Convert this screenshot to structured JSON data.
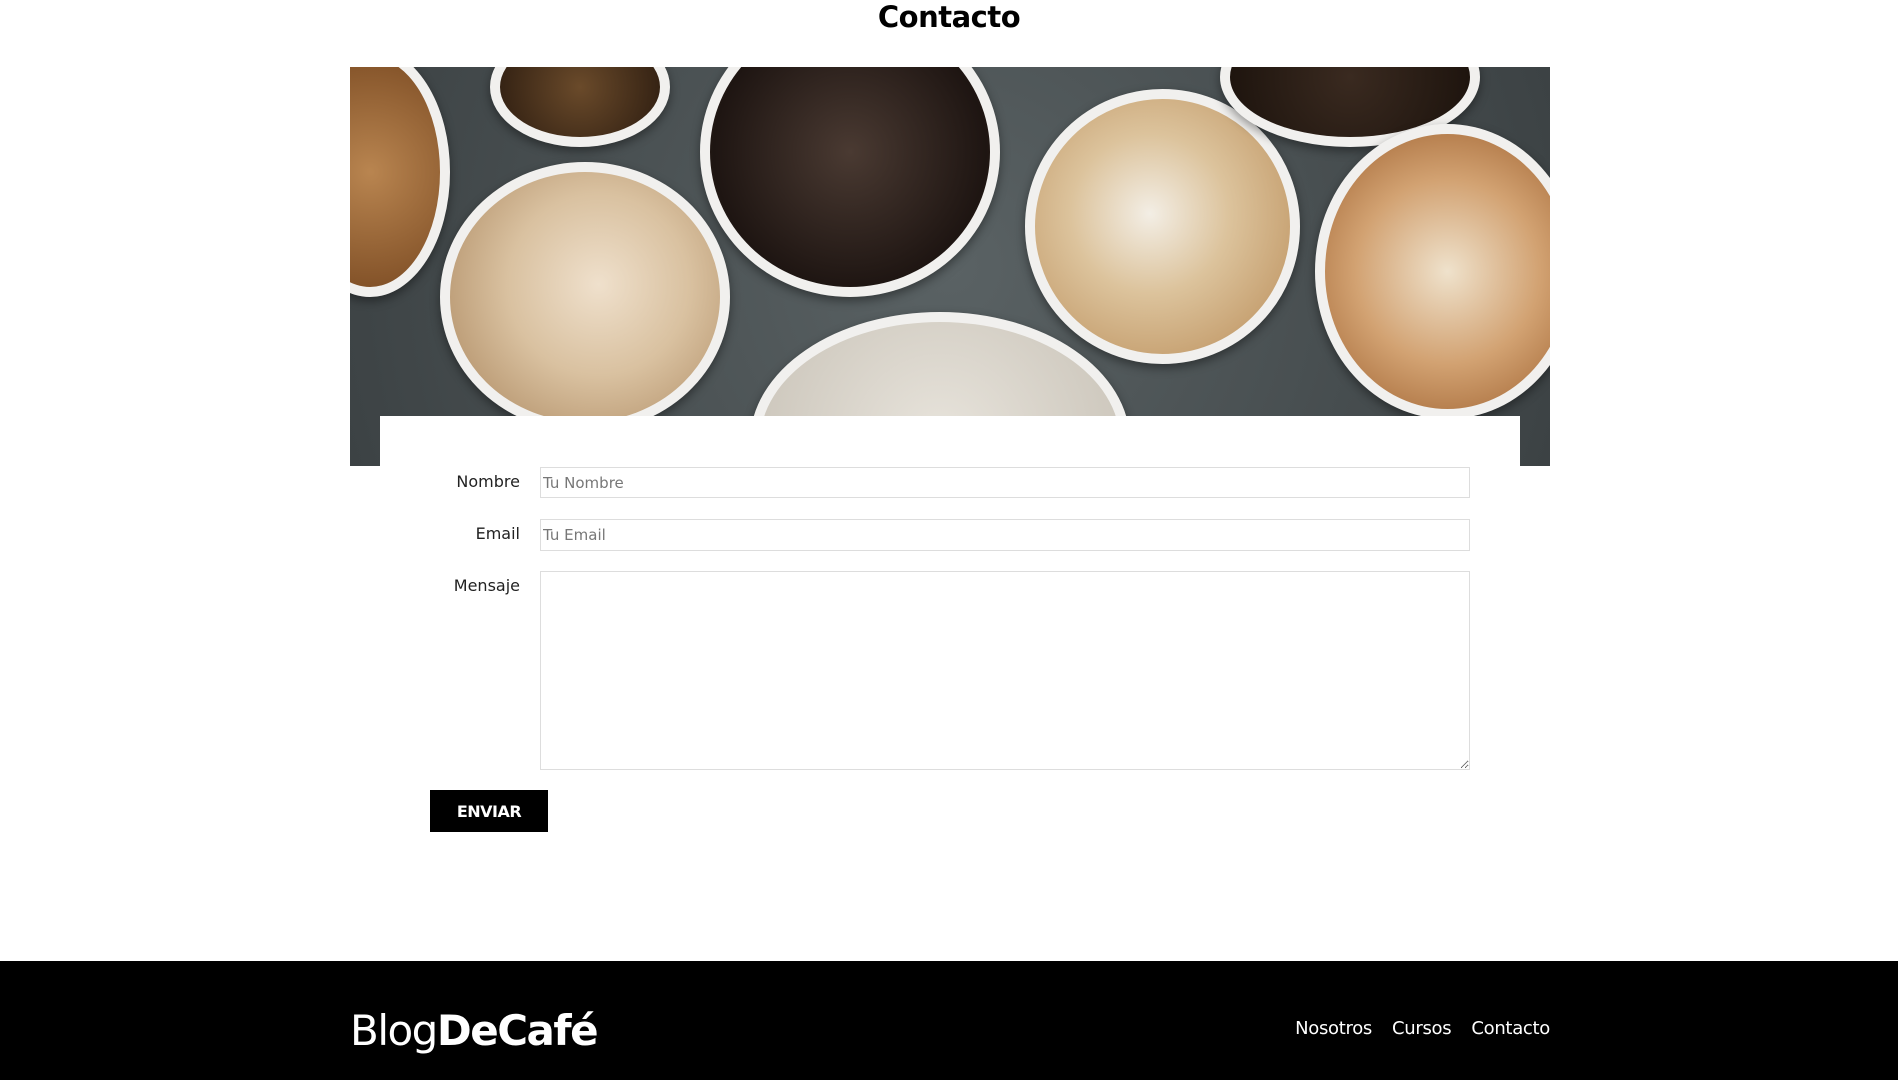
{
  "page": {
    "title": "Contacto"
  },
  "hero": {
    "image": "coffee-cups-top-view"
  },
  "form": {
    "fields": [
      {
        "label": "Nombre",
        "placeholder": "Tu Nombre",
        "value": ""
      },
      {
        "label": "Email",
        "placeholder": "Tu Email",
        "value": ""
      },
      {
        "label": "Mensaje",
        "placeholder": "",
        "value": ""
      }
    ],
    "submit_label": "ENVIAR"
  },
  "footer": {
    "logo_light": "Blog",
    "logo_bold": "DeCafé",
    "nav": [
      "Nosotros",
      "Cursos",
      "Contacto"
    ]
  }
}
